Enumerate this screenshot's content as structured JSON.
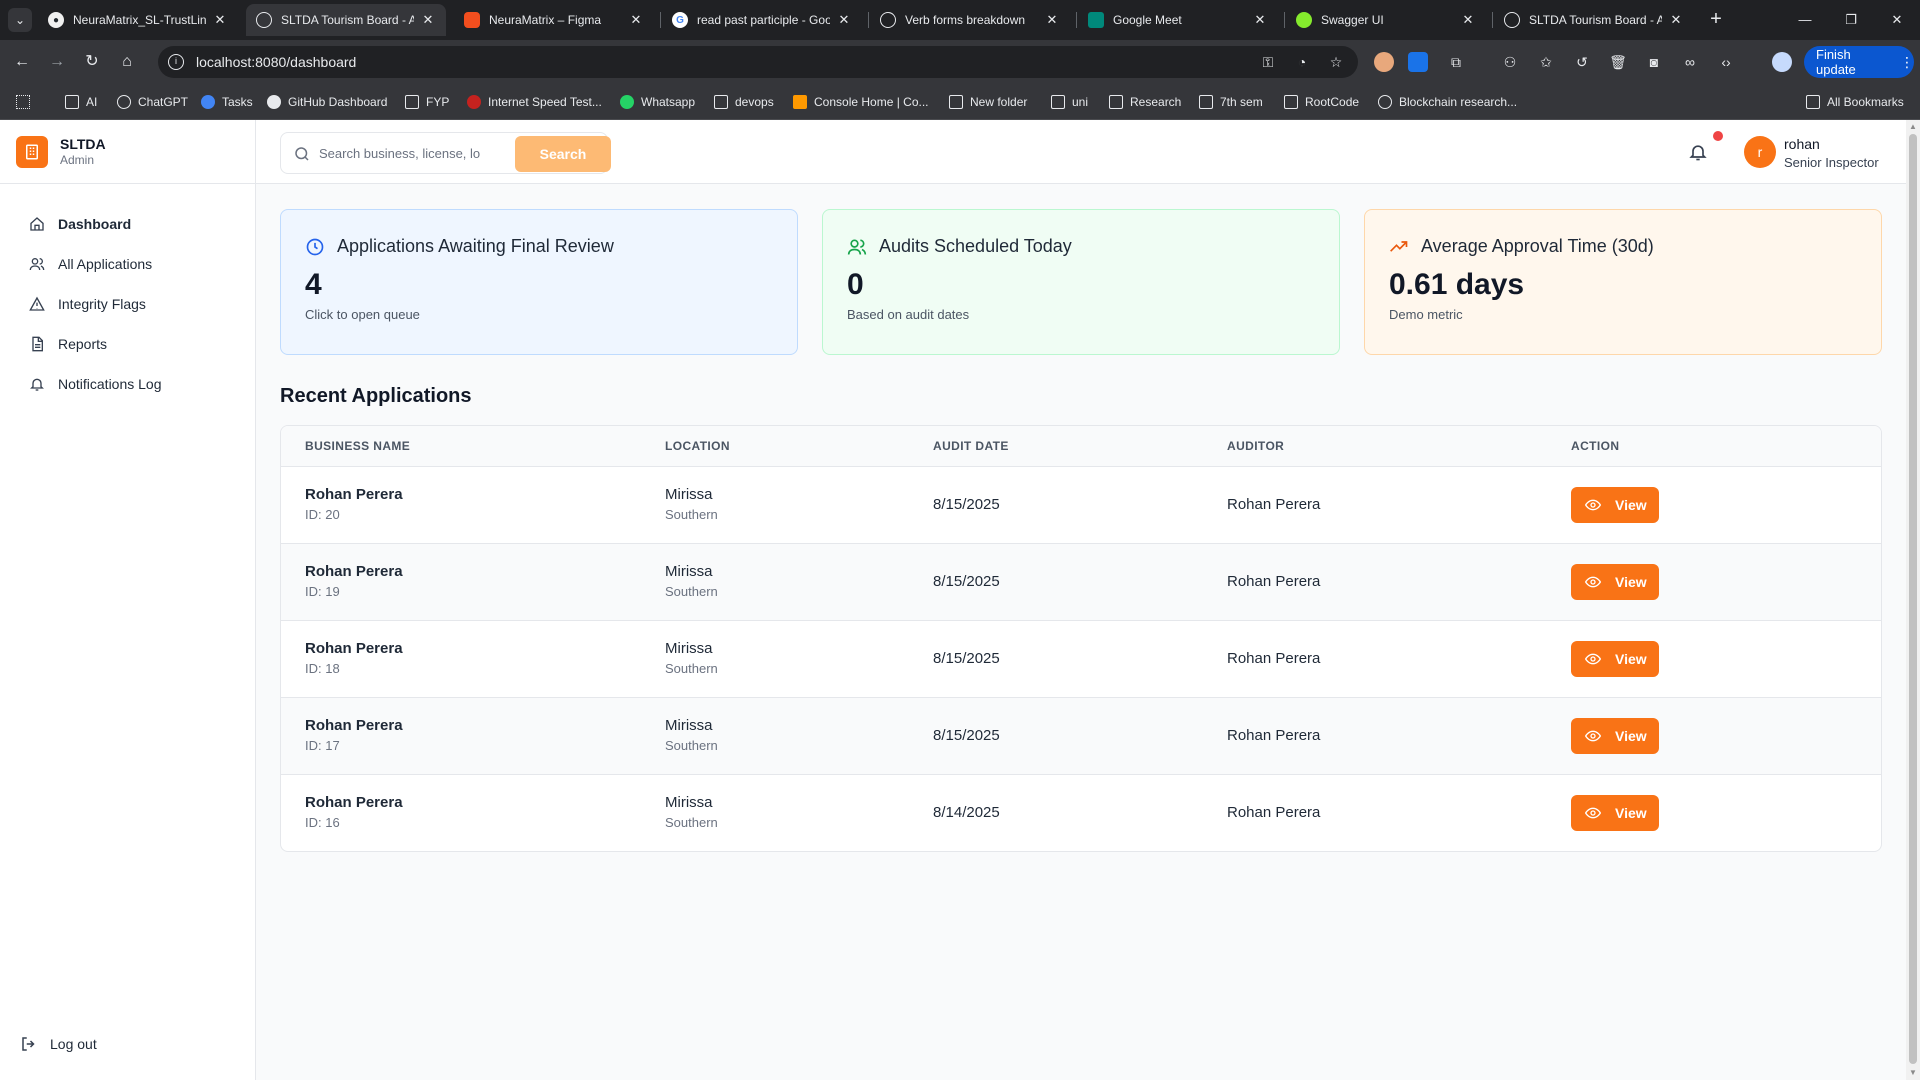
{
  "browser": {
    "tabs": [
      {
        "title": "NeuraMatrix_SL-TrustLink",
        "favicon": "github-icon",
        "color": "#24292f",
        "active": false
      },
      {
        "title": "SLTDA Tourism Board - Ad",
        "favicon": "globe-icon",
        "color": "#5f6368",
        "active": true
      },
      {
        "title": "NeuraMatrix – Figma",
        "favicon": "figma-icon",
        "color": "#f24e1e",
        "active": false
      },
      {
        "title": "read past participle - Goo",
        "favicon": "google-icon",
        "color": "#4285f4",
        "active": false
      },
      {
        "title": "Verb forms breakdown",
        "favicon": "openai-icon",
        "color": "#5f6368",
        "active": false
      },
      {
        "title": "Google Meet",
        "favicon": "meet-icon",
        "color": "#00897b",
        "active": false
      },
      {
        "title": "Swagger UI",
        "favicon": "swagger-icon",
        "color": "#85ea2d",
        "active": false
      },
      {
        "title": "SLTDA Tourism Board - Ad",
        "favicon": "globe-icon",
        "color": "#5f6368",
        "active": false
      }
    ],
    "url": "localhost:8080/dashboard",
    "finish_update_label": "Finish update",
    "bookmarks": [
      {
        "label": "AI",
        "icon": "folder-icon"
      },
      {
        "label": "ChatGPT",
        "icon": "openai-icon"
      },
      {
        "label": "Tasks",
        "icon": "tasks-icon"
      },
      {
        "label": "GitHub Dashboard",
        "icon": "github-icon"
      },
      {
        "label": "FYP",
        "icon": "folder-icon"
      },
      {
        "label": "Internet Speed Test...",
        "icon": "speedtest-icon"
      },
      {
        "label": "Whatsapp",
        "icon": "whatsapp-icon"
      },
      {
        "label": "devops",
        "icon": "folder-icon"
      },
      {
        "label": "Console Home | Co...",
        "icon": "aws-icon"
      },
      {
        "label": "New folder",
        "icon": "folder-icon"
      },
      {
        "label": "uni",
        "icon": "folder-icon"
      },
      {
        "label": "Research",
        "icon": "folder-icon"
      },
      {
        "label": "7th sem",
        "icon": "folder-icon"
      },
      {
        "label": "RootCode",
        "icon": "folder-icon"
      },
      {
        "label": "Blockchain research...",
        "icon": "openai-icon"
      }
    ],
    "all_bookmarks_label": "All Bookmarks"
  },
  "brand": {
    "name": "SLTDA",
    "role": "Admin",
    "accent": "#f97316"
  },
  "sidebar": {
    "items": [
      {
        "label": "Dashboard",
        "icon": "home-icon"
      },
      {
        "label": "All Applications",
        "icon": "users-icon"
      },
      {
        "label": "Integrity Flags",
        "icon": "alert-triangle-icon"
      },
      {
        "label": "Reports",
        "icon": "file-text-icon"
      },
      {
        "label": "Notifications Log",
        "icon": "bell-icon"
      }
    ],
    "logout_label": "Log out"
  },
  "topbar": {
    "search_placeholder": "Search business, license, lo",
    "search_button": "Search",
    "user": {
      "initial": "r",
      "name": "rohan",
      "role": "Senior Inspector"
    }
  },
  "cards": [
    {
      "title": "Applications Awaiting Final Review",
      "value": "4",
      "subtitle": "Click to open queue",
      "icon": "clock-icon",
      "color": "#2563eb"
    },
    {
      "title": "Audits Scheduled Today",
      "value": "0",
      "subtitle": "Based on audit dates",
      "icon": "users-icon",
      "color": "#16a34a"
    },
    {
      "title": "Average Approval Time (30d)",
      "value": "0.61 days",
      "subtitle": "Demo metric",
      "icon": "trending-up-icon",
      "color": "#ea580c"
    }
  ],
  "recent": {
    "title": "Recent Applications",
    "columns": [
      "BUSINESS NAME",
      "LOCATION",
      "AUDIT DATE",
      "AUDITOR",
      "ACTION"
    ],
    "rows": [
      {
        "name": "Rohan Perera",
        "id": "ID: 20",
        "location": "Mirissa",
        "province": "Southern",
        "audit_date": "8/15/2025",
        "auditor": "Rohan Perera",
        "action": "View"
      },
      {
        "name": "Rohan Perera",
        "id": "ID: 19",
        "location": "Mirissa",
        "province": "Southern",
        "audit_date": "8/15/2025",
        "auditor": "Rohan Perera",
        "action": "View"
      },
      {
        "name": "Rohan Perera",
        "id": "ID: 18",
        "location": "Mirissa",
        "province": "Southern",
        "audit_date": "8/15/2025",
        "auditor": "Rohan Perera",
        "action": "View"
      },
      {
        "name": "Rohan Perera",
        "id": "ID: 17",
        "location": "Mirissa",
        "province": "Southern",
        "audit_date": "8/15/2025",
        "auditor": "Rohan Perera",
        "action": "View"
      },
      {
        "name": "Rohan Perera",
        "id": "ID: 16",
        "location": "Mirissa",
        "province": "Southern",
        "audit_date": "8/14/2025",
        "auditor": "Rohan Perera",
        "action": "View"
      }
    ]
  }
}
